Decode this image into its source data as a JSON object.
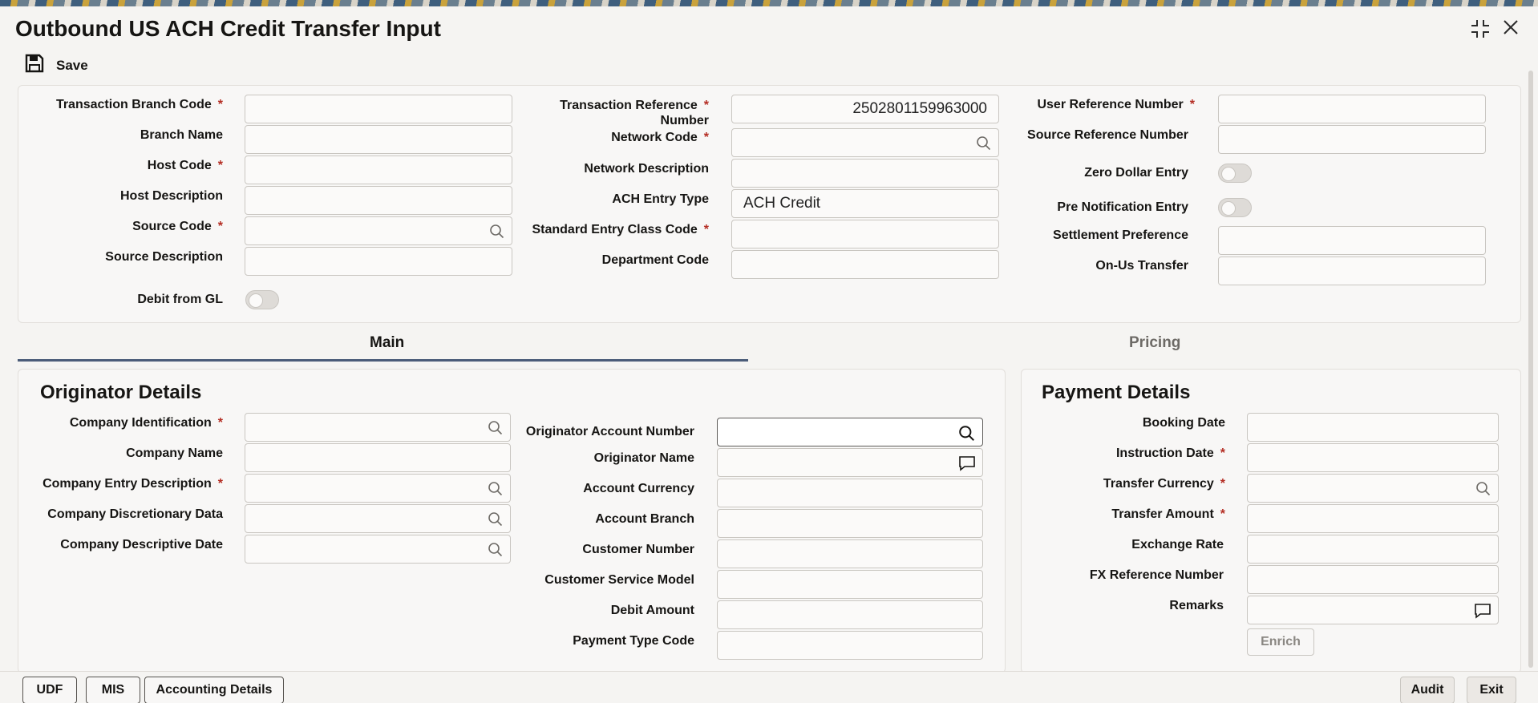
{
  "window": {
    "title": "Outbound US ACH Credit Transfer Input"
  },
  "toolbar": {
    "save_label": "Save"
  },
  "header": {
    "col1": [
      {
        "label": "Transaction Branch Code",
        "required": true,
        "value": ""
      },
      {
        "label": "Branch Name",
        "required": false,
        "value": ""
      },
      {
        "label": "Host Code",
        "required": true,
        "value": ""
      },
      {
        "label": "Host Description",
        "required": false,
        "value": ""
      },
      {
        "label": "Source Code",
        "required": true,
        "value": ""
      },
      {
        "label": "Source Description",
        "required": false,
        "value": ""
      },
      {
        "label": "Debit from GL",
        "type": "toggle",
        "on": false
      }
    ],
    "col2": [
      {
        "label_line1": "Transaction Reference",
        "label_line2": "Number",
        "required": true,
        "value": "2502801159963000"
      },
      {
        "label": "Network Code",
        "required": true,
        "value": ""
      },
      {
        "label": "Network Description",
        "required": false,
        "value": ""
      },
      {
        "label": "ACH Entry Type",
        "required": false,
        "value": "ACH Credit"
      },
      {
        "label": "Standard Entry Class Code",
        "required": true,
        "value": ""
      },
      {
        "label": "Department Code",
        "required": false,
        "value": ""
      }
    ],
    "col3": [
      {
        "label": "User Reference Number",
        "required": true,
        "value": ""
      },
      {
        "label": "Source Reference Number",
        "required": false,
        "value": ""
      },
      {
        "label": "Zero Dollar Entry",
        "type": "toggle",
        "on": false
      },
      {
        "label": "Pre Notification Entry",
        "type": "toggle",
        "on": false
      },
      {
        "label": "Settlement Preference",
        "required": false,
        "value": ""
      },
      {
        "label": "On-Us Transfer",
        "required": false,
        "value": ""
      }
    ],
    "required_mark": "*"
  },
  "tabs": [
    {
      "label": "Main",
      "active": true
    },
    {
      "label": "Pricing",
      "active": false
    }
  ],
  "originator": {
    "title": "Originator Details",
    "left": [
      {
        "label": "Company Identification",
        "required": true,
        "value": ""
      },
      {
        "label": "Company Name",
        "required": false,
        "value": ""
      },
      {
        "label": "Company Entry Description",
        "required": true,
        "value": ""
      },
      {
        "label": "Company Discretionary Data",
        "required": false,
        "value": ""
      },
      {
        "label": "Company Descriptive Date",
        "required": false,
        "value": ""
      }
    ],
    "right": [
      {
        "label": "Originator Account Number",
        "value": ""
      },
      {
        "label": "Originator Name",
        "value": ""
      },
      {
        "label": "Account Currency",
        "value": ""
      },
      {
        "label": "Account Branch",
        "value": ""
      },
      {
        "label": "Customer Number",
        "value": ""
      },
      {
        "label": "Customer Service Model",
        "value": ""
      },
      {
        "label": "Debit Amount",
        "value": ""
      },
      {
        "label": "Payment Type Code",
        "value": ""
      }
    ]
  },
  "payment": {
    "title": "Payment Details",
    "fields": [
      {
        "label": "Booking Date",
        "required": false,
        "value": ""
      },
      {
        "label": "Instruction Date",
        "required": true,
        "value": ""
      },
      {
        "label": "Transfer Currency",
        "required": true,
        "value": ""
      },
      {
        "label": "Transfer Amount",
        "required": true,
        "value": ""
      },
      {
        "label": "Exchange Rate",
        "required": false,
        "value": ""
      },
      {
        "label": "FX Reference Number",
        "required": false,
        "value": ""
      },
      {
        "label": "Remarks",
        "required": false,
        "value": ""
      }
    ],
    "enrich_label": "Enrich"
  },
  "footer": {
    "udf_label": "UDF",
    "mis_label": "MIS",
    "accounting_label": "Accounting Details",
    "audit_label": "Audit",
    "exit_label": "Exit"
  },
  "colors": {
    "required": "#b42c22",
    "tab_indicator": "#4b5c79"
  }
}
